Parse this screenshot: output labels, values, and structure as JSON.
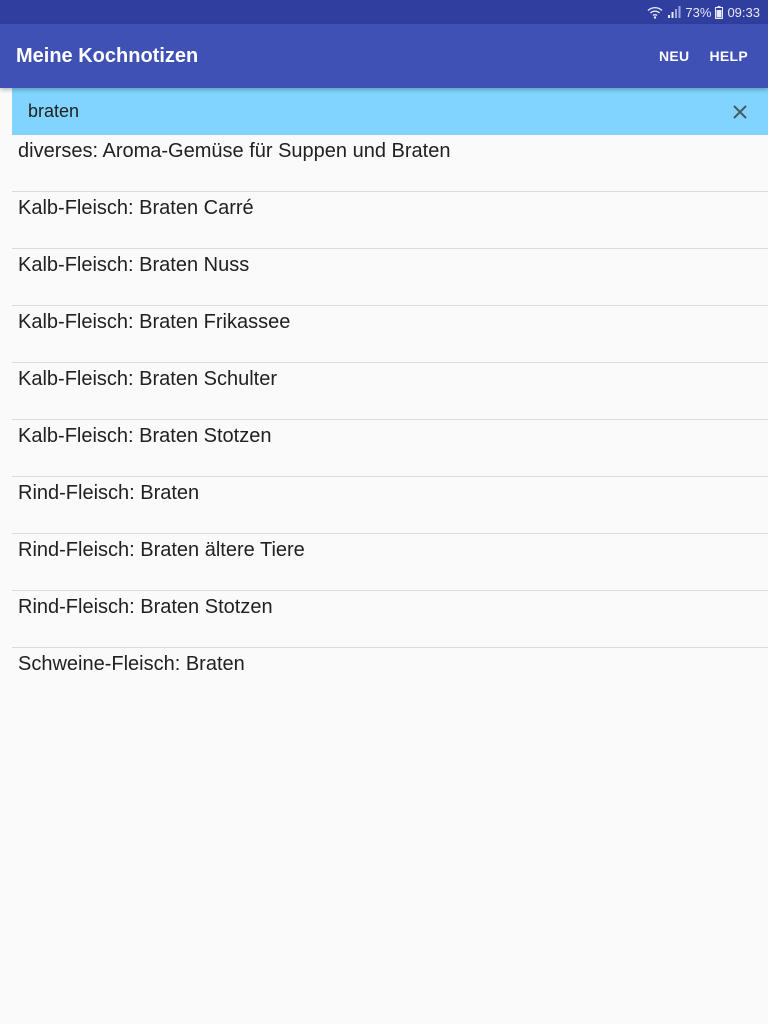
{
  "status_bar": {
    "battery": "73%",
    "time": "09:33",
    "icons": [
      "wifi-icon",
      "signal-icon",
      "battery-icon"
    ]
  },
  "app_bar": {
    "title": "Meine Kochnotizen",
    "actions": [
      {
        "label": "NEU"
      },
      {
        "label": "HELP"
      }
    ],
    "color": "#3f51b5"
  },
  "search": {
    "value": "braten",
    "clear_icon": "close-icon",
    "background": "#80d4ff"
  },
  "results": [
    {
      "label": "diverses: Aroma-Gemüse für Suppen und Braten"
    },
    {
      "label": "Kalb-Fleisch: Braten  Carré"
    },
    {
      "label": "Kalb-Fleisch: Braten  Nuss"
    },
    {
      "label": "Kalb-Fleisch: Braten Frikassee"
    },
    {
      "label": "Kalb-Fleisch: Braten Schulter"
    },
    {
      "label": "Kalb-Fleisch: Braten Stotzen"
    },
    {
      "label": "Rind-Fleisch: Braten"
    },
    {
      "label": "Rind-Fleisch: Braten ältere Tiere"
    },
    {
      "label": "Rind-Fleisch: Braten Stotzen"
    },
    {
      "label": "Schweine-Fleisch: Braten"
    }
  ]
}
